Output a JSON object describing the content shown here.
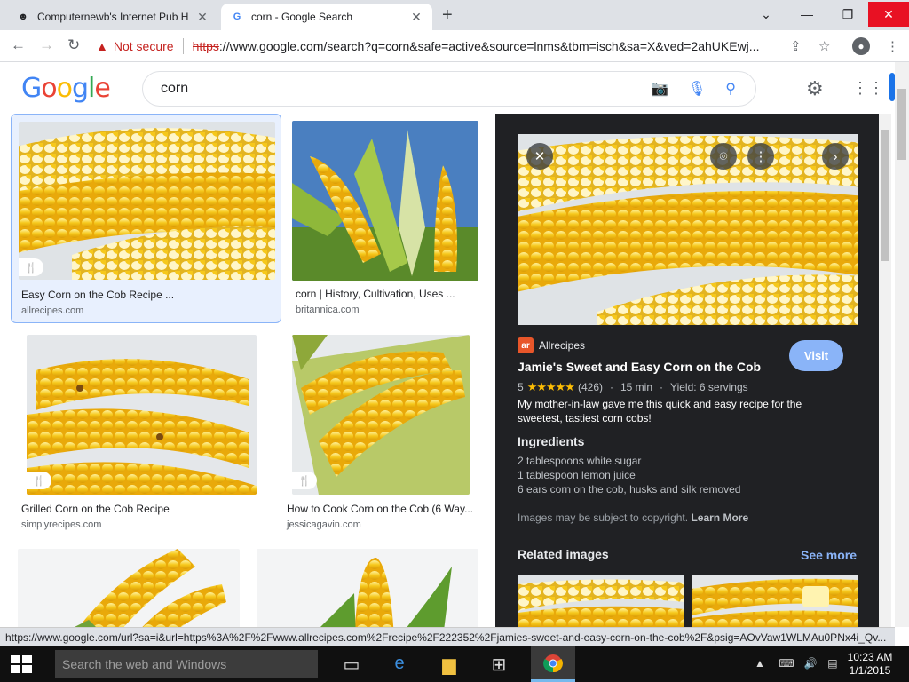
{
  "browser": {
    "tabs": [
      {
        "title": "Computernewb's Internet Pub H",
        "icon": "pub-favicon"
      },
      {
        "title": "corn - Google Search",
        "icon": "google-favicon"
      }
    ],
    "not_secure": "Not secure",
    "url_scheme": "https",
    "url_rest": "://www.google.com/search?q=corn&safe=active&source=lnms&tbm=isch&sa=X&ved=2ahUKEwj...",
    "status_url": "https://www.google.com/url?sa=i&url=https%3A%2F%2Fwww.allrecipes.com%2Frecipe%2F222352%2Fjamies-sweet-and-easy-corn-on-the-cob%2F&psig=AOvVaw1WLMAu0PNx4i_Qv..."
  },
  "google": {
    "logo": [
      "G",
      "o",
      "o",
      "g",
      "l",
      "e"
    ],
    "query": "corn"
  },
  "results": [
    {
      "caption": "Easy Corn on the Cob Recipe ...",
      "source": "allrecipes.com"
    },
    {
      "caption": "corn | History, Cultivation, Uses ...",
      "source": "britannica.com"
    },
    {
      "caption": "Grilled Corn on the Cob Recipe",
      "source": "simplyrecipes.com"
    },
    {
      "caption": "How to Cook Corn on the Cob (6 Way...",
      "source": "jessicagavin.com"
    }
  ],
  "panel": {
    "source_name": "Allrecipes",
    "source_logo": "ar",
    "visit_label": "Visit",
    "title": "Jamie's Sweet and Easy Corn on the Cob",
    "rating_value": "5",
    "reviews": "(426)",
    "time": "15 min",
    "yield": "Yield: 6 servings",
    "description": "My mother-in-law gave me this quick and easy recipe for the sweetest, tastiest corn cobs!",
    "ingredients_heading": "Ingredients",
    "ingredients": [
      "2 tablespoons white sugar",
      "1 tablespoon lemon juice",
      "6 ears corn on the cob, husks and silk removed"
    ],
    "copyright": "Images may be subject to copyright.",
    "learn_more": "Learn More",
    "related_heading": "Related images",
    "see_more": "See more"
  },
  "taskbar": {
    "search_placeholder": "Search the web and Windows",
    "time": "10:23 AM",
    "date": "1/1/2015"
  },
  "colors": {
    "accent": "#1a73e8",
    "panel_bg": "#202124",
    "visit": "#8ab4f8",
    "star": "#fbbc04"
  }
}
